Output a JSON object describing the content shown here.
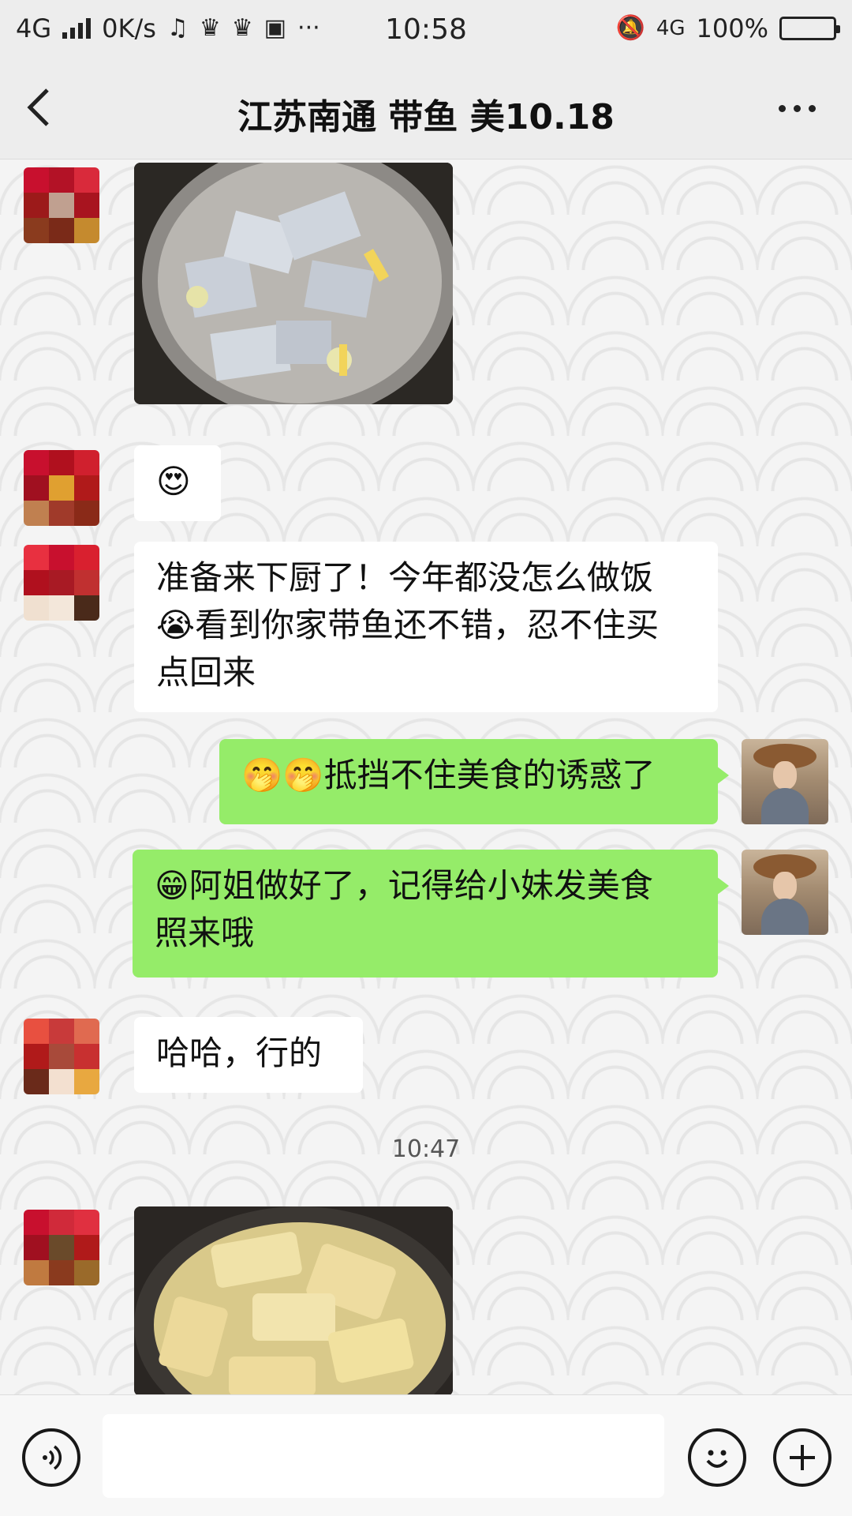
{
  "status_bar": {
    "network": "4G",
    "speed": "0K/s",
    "time": "10:58",
    "network_right": "4G",
    "battery": "100%",
    "battery_level": 1.0
  },
  "nav": {
    "title": "江苏南通 带鱼 美10.18",
    "back_icon": "chevron-left-icon",
    "more_icon": "more-icon"
  },
  "messages": {
    "m2_text": "😍",
    "m3_line1": "准备来下厨了！今年都没怎么做饭",
    "m3_line2": "😭看到你家带鱼还不错，忍不住买",
    "m3_line3": "点回来",
    "m4_text": "🤭🤭抵挡不住美食的诱惑了",
    "m5_line1": "😁阿姐做好了，记得给小妹发美食",
    "m5_line2": "照来哦",
    "m6_text": "哈哈，行的",
    "timestamp": "10:47"
  },
  "input_bar": {
    "voice_icon": "voice-icon",
    "emoji_icon": "emoji-icon",
    "plus_icon": "plus-icon",
    "placeholder": ""
  },
  "colors": {
    "outgoing_bubble": "#95ec69",
    "incoming_bubble": "#ffffff",
    "background": "#ededed"
  }
}
